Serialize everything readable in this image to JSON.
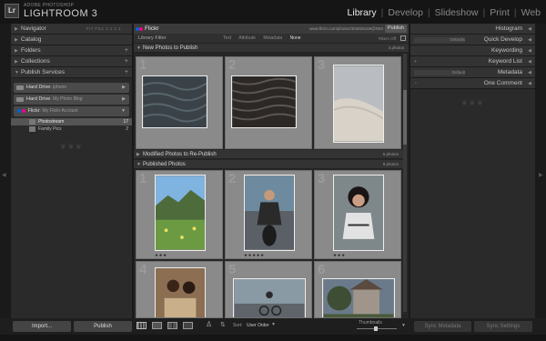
{
  "app": {
    "logo": "Lr",
    "brand_sub": "ADOBE PHOTOSHOP",
    "brand": "LIGHTROOM 3"
  },
  "modules": [
    "Library",
    "Develop",
    "Slideshow",
    "Print",
    "Web"
  ],
  "active_module": "Library",
  "left_panel": {
    "navigator": {
      "label": "Navigator",
      "options": "FIT  FILL  1:1  1:1"
    },
    "catalog": {
      "label": "Catalog"
    },
    "folders": {
      "label": "Folders",
      "action": "+"
    },
    "collections": {
      "label": "Collections",
      "action": "+"
    },
    "publish_services": {
      "label": "Publish Services",
      "action": "+"
    },
    "services": [
      {
        "name": "Hard Drive",
        "sub": ": iphone"
      },
      {
        "name": "Hard Drive",
        "sub": ": My Photo Blog"
      },
      {
        "name": "Flickr",
        "sub": ": My Flickr Account"
      }
    ],
    "collections_list": [
      {
        "name": "Photostream",
        "count": "17"
      },
      {
        "name": "Family Pics",
        "count": "2"
      }
    ],
    "import_label": "Import...",
    "publish_label": "Publish"
  },
  "center": {
    "service_title": "Flickr",
    "url": "www.flickr.com/photos/304826168@N00",
    "publish_button": "Publish",
    "filter_label": "Library Filter",
    "filter_tabs": [
      "Text",
      "Attribute",
      "Metadata",
      "None"
    ],
    "filters_off": "Filters Off",
    "sections": {
      "new": {
        "label": "New Photos to Publish",
        "count": "3 photos"
      },
      "modified": {
        "label": "Modified Photos to Re-Publish",
        "count": "6 photos"
      },
      "published": {
        "label": "Published Photos",
        "count": "8 photos"
      }
    },
    "cell_numbers": [
      "1",
      "2",
      "3",
      "1",
      "2",
      "3",
      "4",
      "5",
      "6"
    ],
    "stars": [
      "★★★",
      "★★★★★",
      "★★★"
    ],
    "toolbar": {
      "sort_label": "Sort:",
      "sort_value": "User Order",
      "thumbnails_label": "Thumbnails"
    }
  },
  "right_panel": {
    "histogram": {
      "label": "Histogram"
    },
    "quick_develop": {
      "label": "Quick Develop",
      "preset": "Defaults"
    },
    "keywording": {
      "label": "Keywording"
    },
    "keyword_list": {
      "label": "Keyword List",
      "action": "+"
    },
    "metadata": {
      "label": "Metadata",
      "preset": "Default"
    },
    "comments": {
      "label": "One Comment"
    },
    "sync_metadata": "Sync Metadata",
    "sync_settings": "Sync Settings"
  },
  "colors": {
    "flickr_blue": "#0063dc",
    "flickr_pink": "#ff0084",
    "accent": "#e8e8e8"
  }
}
